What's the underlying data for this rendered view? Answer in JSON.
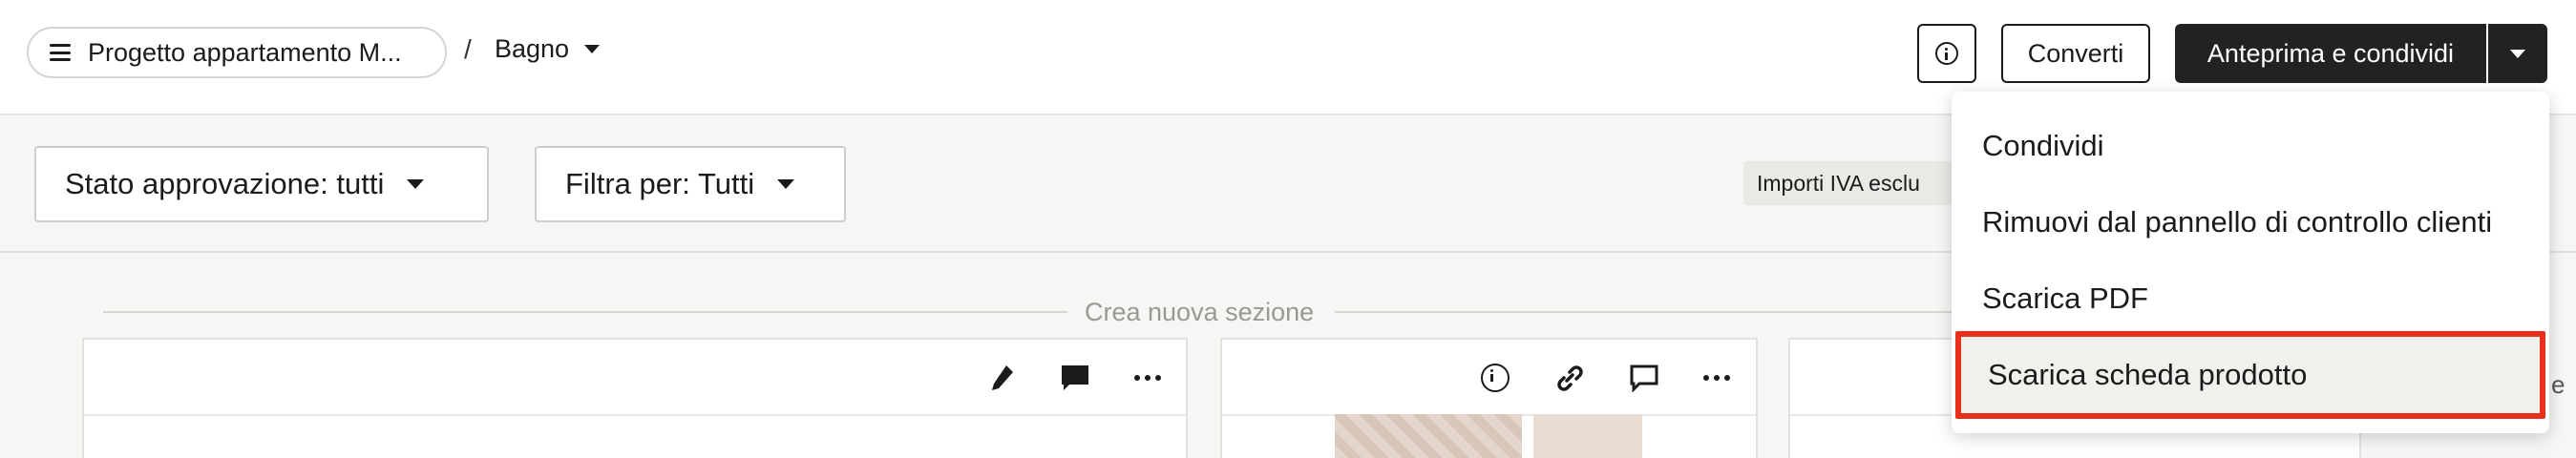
{
  "topbar": {
    "project_label": "Progetto appartamento M...",
    "breadcrumb_separator": "/",
    "room_label": "Bagno",
    "convert_label": "Converti",
    "preview_label": "Anteprima e condividi"
  },
  "filters": {
    "approval_label": "Stato approvazione: tutti",
    "filter_by_label": "Filtra per: Tutti",
    "vat_label": "Importi IVA esclu"
  },
  "board": {
    "new_section_label": "Crea nuova sezione"
  },
  "dropdown": {
    "items": [
      {
        "label": "Condividi"
      },
      {
        "label": "Rimuovi dal pannello di controllo clienti"
      },
      {
        "label": "Scarica PDF"
      },
      {
        "label": "Scarica scheda prodotto"
      }
    ],
    "highlight_color": "#e8311a"
  },
  "edge_text": "e"
}
